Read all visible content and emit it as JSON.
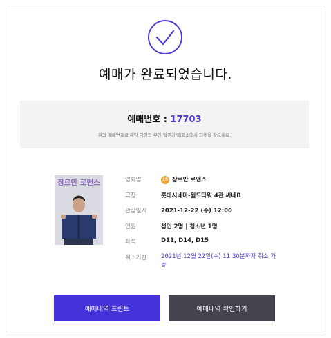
{
  "title": "예매가 완료되었습니다.",
  "booking": {
    "number_label": "예매번호 : ",
    "number": "17703",
    "note": "위의 예매번호로 해당 극장의 무인 발권기/매표소에서 티켓을 찾으세요."
  },
  "poster": {
    "title_text": "장르만 로맨스"
  },
  "details": {
    "age_rating": "15",
    "rows": [
      {
        "label": "영화명",
        "value": "장르만 로맨스"
      },
      {
        "label": "극장",
        "value": "롯데시네마-월드타워 4관 씨네B"
      },
      {
        "label": "관람일시",
        "value": "2021-12-22 (수) 12:00"
      },
      {
        "label": "인원",
        "value": "성인 2명 | 청소년 1명"
      },
      {
        "label": "좌석",
        "value": "D11, D14, D15"
      },
      {
        "label": "취소기한",
        "value": "2021년 12월 22일(수) 11:30분까지 취소 가능"
      }
    ]
  },
  "buttons": {
    "print": "예매내역 프린트",
    "confirm": "예매내역 확인하기"
  },
  "colors": {
    "accent": "#4532d9",
    "dark_button": "#46434f",
    "rating": "#f0a030"
  }
}
